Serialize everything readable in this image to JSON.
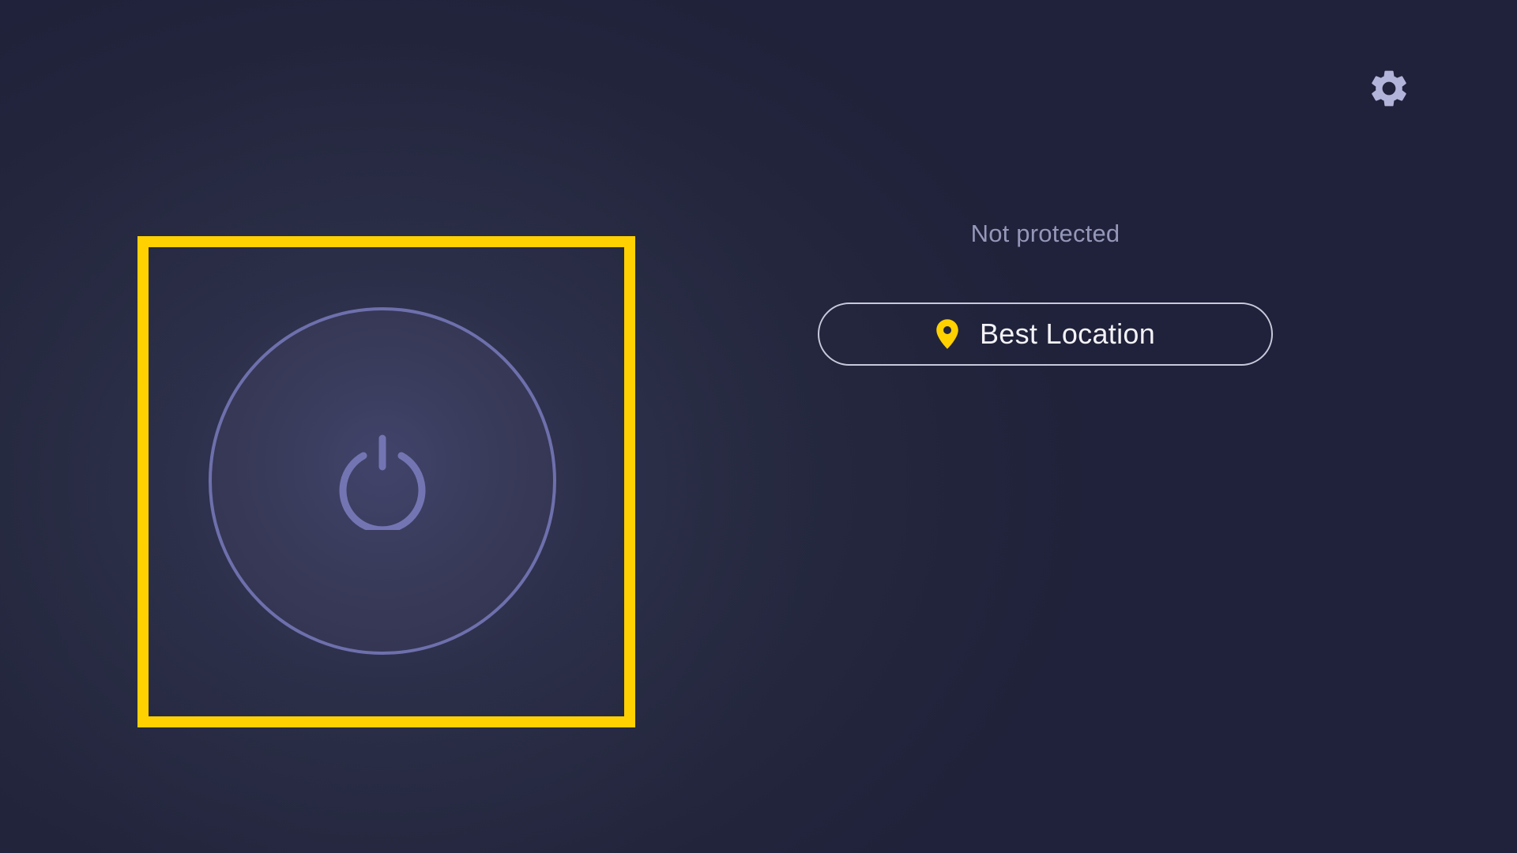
{
  "header": {
    "settings_icon": "gear-icon"
  },
  "connection": {
    "power_icon": "power-icon",
    "status_text": "Not protected"
  },
  "location": {
    "icon": "location-pin-icon",
    "label": "Best Location"
  },
  "colors": {
    "accent": "#ffd100",
    "ring": "#6e70ad",
    "icon_muted": "#a9abd4",
    "status_text": "#9597b8",
    "background": "#23263c"
  }
}
